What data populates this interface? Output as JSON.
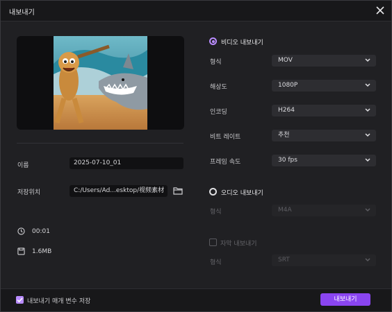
{
  "window": {
    "title": "내보내기"
  },
  "form": {
    "name_label": "이름",
    "name_value": "2025-07-10_01",
    "path_label": "저장위치",
    "path_value": "C:/Users/Ad...esktop/视频素材"
  },
  "meta": {
    "duration": "00:01",
    "size": "1.6MB"
  },
  "video": {
    "title": "비디오 내보내기",
    "rows": [
      {
        "label": "형식",
        "value": "MOV"
      },
      {
        "label": "해상도",
        "value": "1080P"
      },
      {
        "label": "인코딩",
        "value": "H264"
      },
      {
        "label": "비트 레이트",
        "value": "추천"
      },
      {
        "label": "프레임 속도",
        "value": "30  fps"
      }
    ]
  },
  "audio": {
    "title": "오디오 내보내기",
    "format_label": "형식",
    "format_value": "M4A"
  },
  "subtitle": {
    "title": "자막 내보내기",
    "format_label": "형식",
    "format_value": "SRT"
  },
  "footer": {
    "save_params_label": "내보내기 매개 변수 저장",
    "export_label": "내보내기"
  },
  "colors": {
    "accent": "#8a45f0",
    "accent_light": "#b98cff",
    "background": "#202023"
  }
}
